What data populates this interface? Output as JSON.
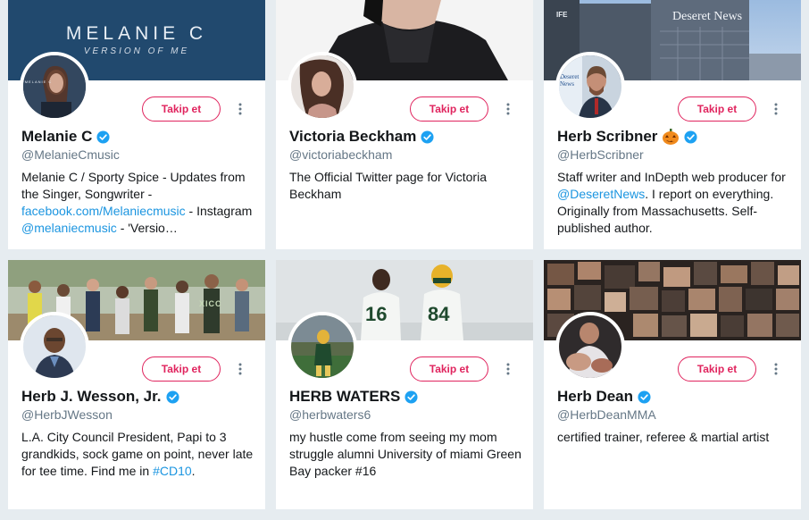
{
  "follow_label": "Takip et",
  "colors": {
    "accent_follow": "#e0245e",
    "link": "#1b95e0",
    "verified": "#1da1f2",
    "background": "#e6ecf0"
  },
  "cards": [
    {
      "name": "Melanie C",
      "handle": "@MelanieCmusic",
      "verified": true,
      "banner_title": "MELANIE C",
      "banner_subtitle": "VERSION OF ME",
      "avatar_text": "MELANIE C",
      "bio_1": "Melanie C / Sporty Spice - Updates from the Singer, Songwriter - ",
      "bio_link_1": "facebook.com/Melaniecmusic",
      "bio_2": " - Instagram ",
      "bio_link_2": "@melaniecmusic",
      "bio_3": " - 'Versio…"
    },
    {
      "name": "Victoria Beckham",
      "handle": "@victoriabeckham",
      "verified": true,
      "bio_1": "The Official Twitter page for Victoria Beckham"
    },
    {
      "name": "Herb Scribner",
      "handle": "@HerbScribner",
      "verified": true,
      "emoji": "pumpkin-icon",
      "banner_sign": "Deseret News",
      "banner_sign_2": "IFE",
      "avatar_text": "Deseret News",
      "bio_1": "Staff writer and InDepth web producer for ",
      "bio_link_1": "@DeseretNews",
      "bio_2": ". I report on everything. Originally from Massachusetts. Self-published author."
    },
    {
      "name": "Herb J. Wesson, Jr.",
      "handle": "@HerbJWesson",
      "verified": true,
      "banner_text": "XICC",
      "bio_1": "L.A. City Council President, Papi to 3 grandkids, sock game on point, never late for tee time. Find me in ",
      "bio_link_1": "#CD10",
      "bio_2": "."
    },
    {
      "name": "HERB WATERS",
      "handle": "@herbwaters6",
      "verified": true,
      "jersey_1": "16",
      "jersey_2": "84",
      "bio_1": "my hustle come from seeing my mom struggle alumni University of miami Green Bay packer #16"
    },
    {
      "name": "Herb Dean",
      "handle": "@HerbDeanMMA",
      "verified": true,
      "bio_1": "certified trainer, referee & martial artist"
    }
  ]
}
